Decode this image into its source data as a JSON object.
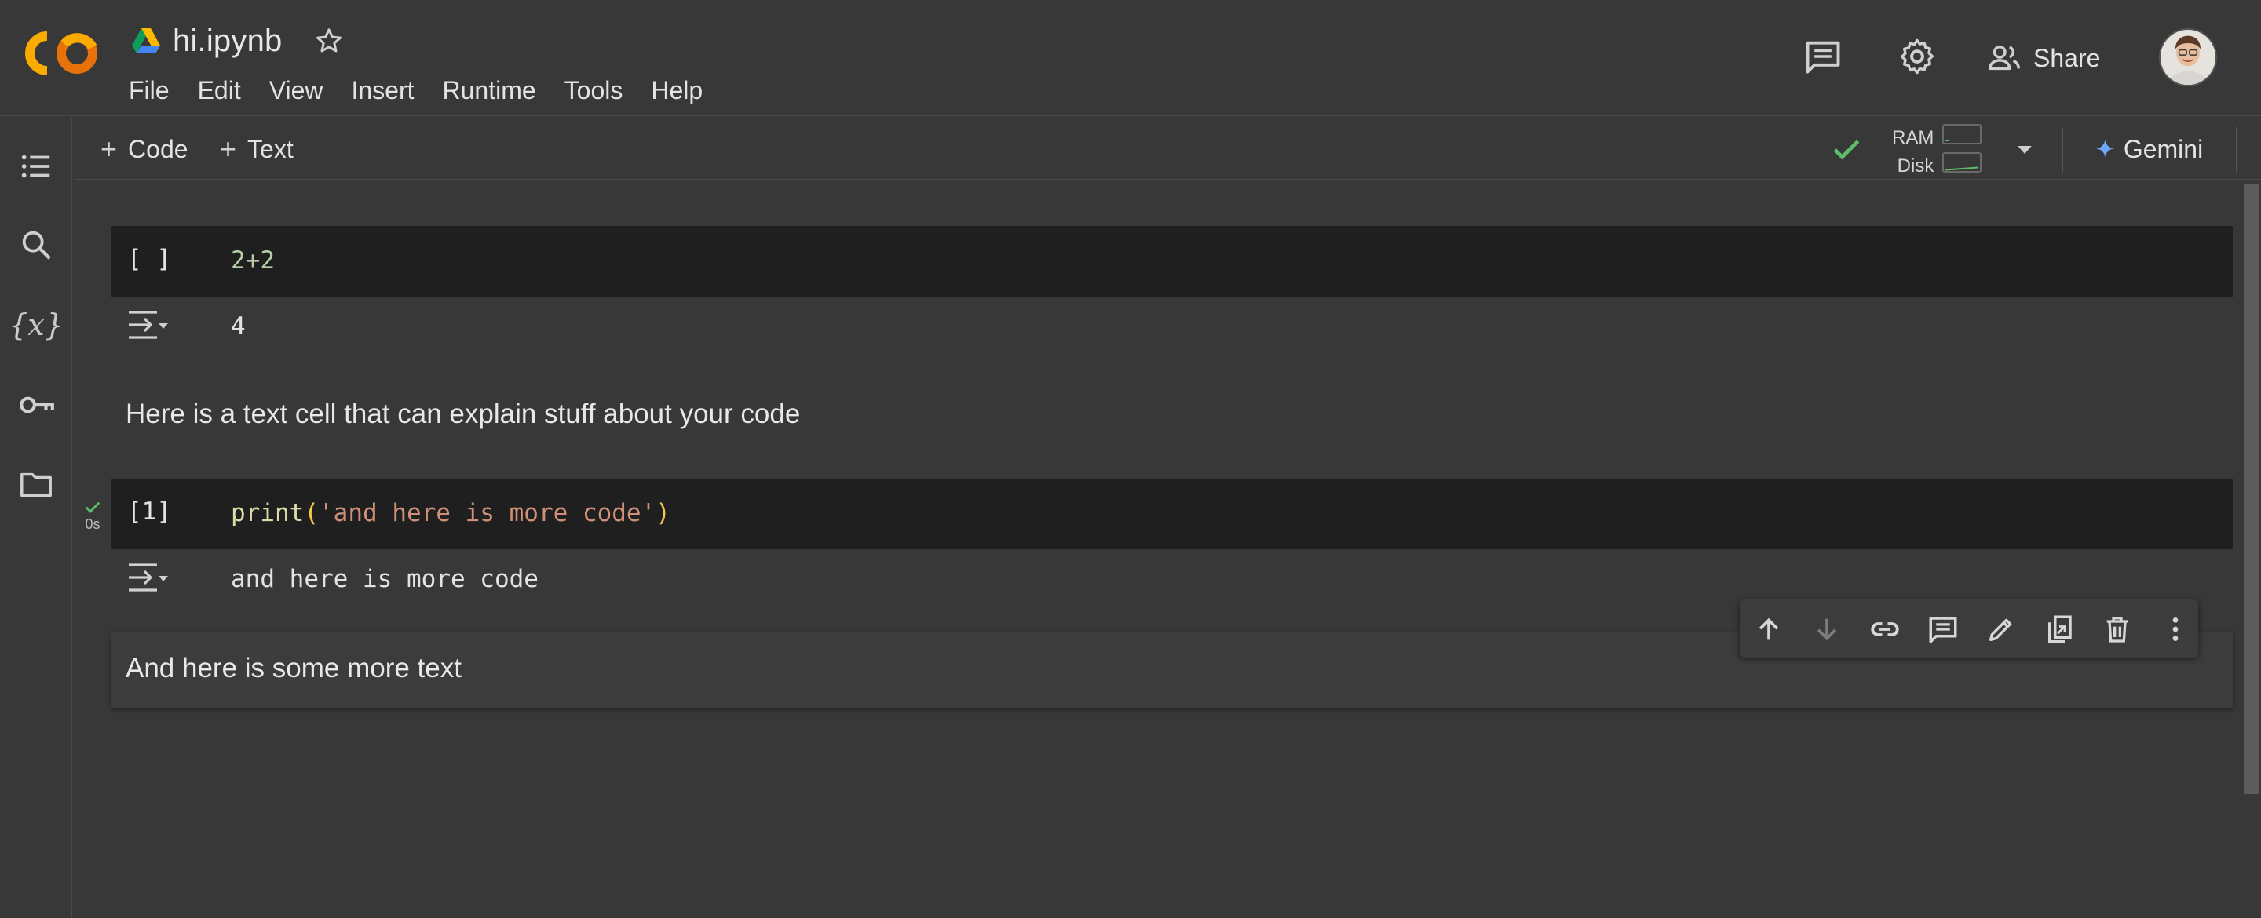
{
  "header": {
    "doc_title": "hi.ipynb",
    "logo_text": "CO",
    "share_label": "Share",
    "menu": [
      "File",
      "Edit",
      "View",
      "Insert",
      "Runtime",
      "Tools",
      "Help"
    ]
  },
  "toolbar": {
    "add_code_label": "Code",
    "add_text_label": "Text",
    "ram_label": "RAM",
    "disk_label": "Disk",
    "gemini_label": "Gemini"
  },
  "notebook": {
    "cells": [
      {
        "type": "code",
        "exec_count": "[ ]",
        "source": "2+2",
        "output": "4"
      },
      {
        "type": "text",
        "text": "Here is a text cell that can explain stuff about your code"
      },
      {
        "type": "code",
        "exec_count": "[1]",
        "run_time": "0s",
        "source_fn": "print",
        "source_open": "(",
        "source_str": "'and here is more code'",
        "source_close": ")",
        "output": "and here is more code"
      },
      {
        "type": "text",
        "text": "And here is some more text"
      }
    ]
  },
  "icons": {
    "rail": [
      "table-of-contents-icon",
      "search-icon",
      "variables-icon",
      "key-icon",
      "folder-icon"
    ],
    "rail_variables_glyph": "{x}",
    "cell_toolbar": [
      "arrow-up-icon",
      "arrow-down-icon",
      "link-icon",
      "comment-icon",
      "edit-icon",
      "mirror-cell-icon",
      "delete-icon",
      "more-vert-icon"
    ]
  },
  "colors": {
    "background": "#383838",
    "code_cell_bg": "#1f1f1f",
    "status_green": "#5bbf6a",
    "gemini_blue": "#6ea8ff",
    "logo_orange": "#f9ab00",
    "logo_dark_orange": "#e8710a"
  }
}
